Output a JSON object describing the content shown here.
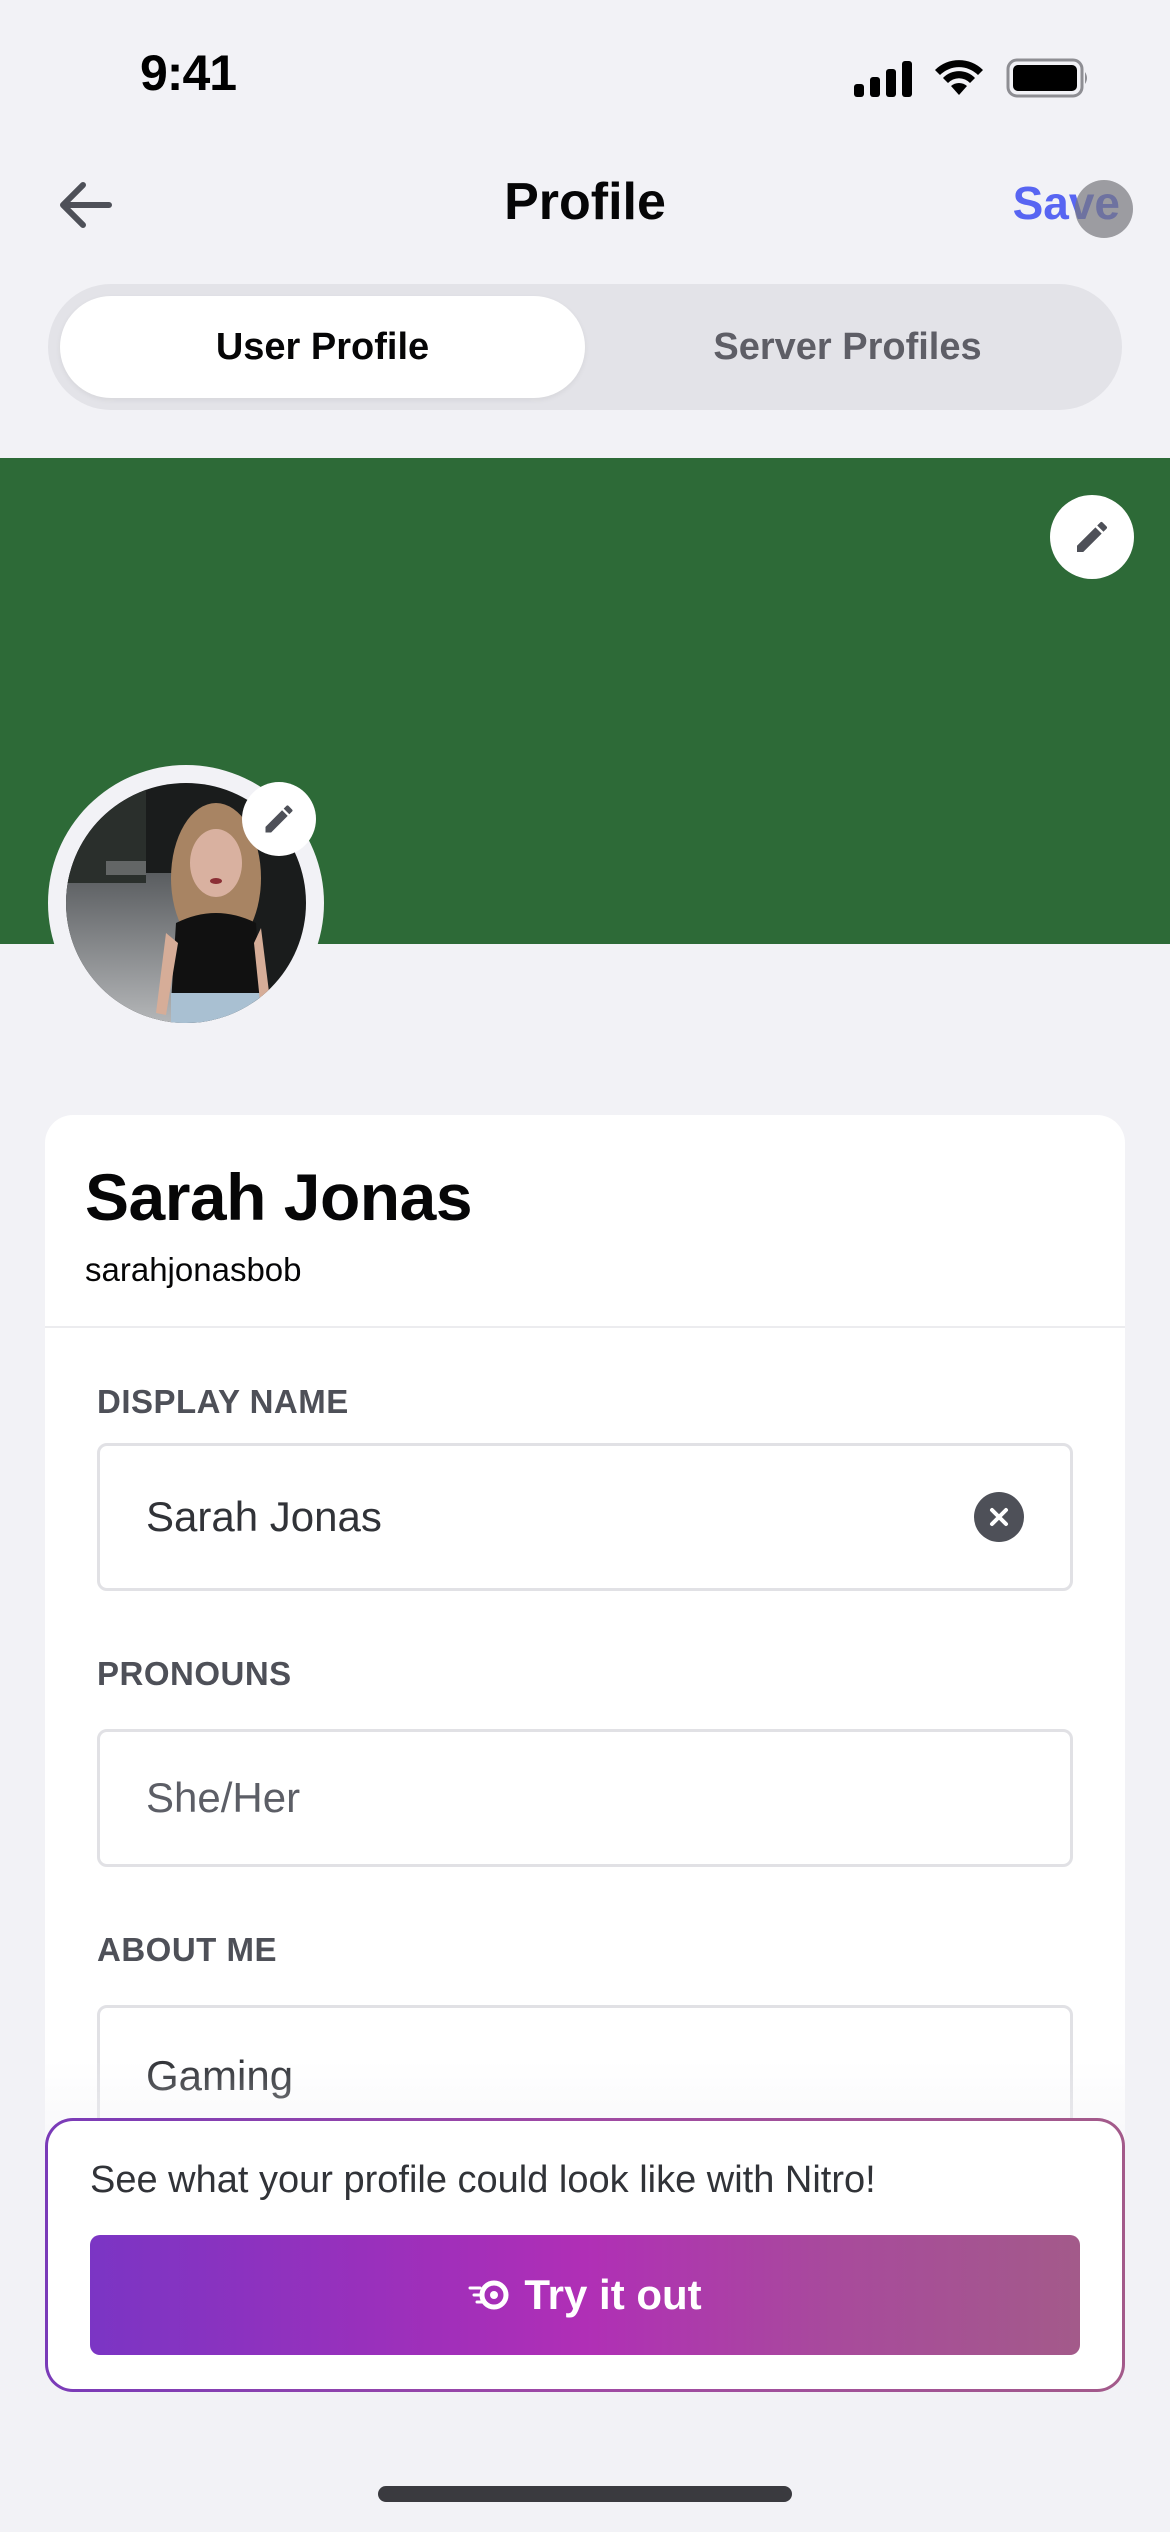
{
  "status_bar": {
    "time": "9:41",
    "icons": [
      "cellular-signal-icon",
      "wifi-icon",
      "battery-icon"
    ]
  },
  "nav": {
    "back_icon": "arrow-left-icon",
    "title": "Profile",
    "save_label": "Save"
  },
  "tabs": [
    {
      "label": "User Profile",
      "active": true
    },
    {
      "label": "Server Profiles",
      "active": false
    }
  ],
  "banner": {
    "color": "#2d6a37",
    "edit_icon": "pencil-icon"
  },
  "avatar": {
    "description": "Profile photo of a woman with long blonde hair in a black tank top",
    "edit_icon": "pencil-icon"
  },
  "profile": {
    "display_name": "Sarah Jonas",
    "username": "sarahjonasbob"
  },
  "form": {
    "display_name": {
      "label": "DISPLAY NAME",
      "value": "Sarah Jonas",
      "clear_icon": "clear-circle-icon"
    },
    "pronouns": {
      "label": "PRONOUNS",
      "placeholder": "She/Her",
      "value": ""
    },
    "about_me": {
      "label": "ABOUT ME",
      "value": "Gaming"
    }
  },
  "nitro_promo": {
    "text": "See what your profile could look like with Nitro!",
    "button_label": "Try it out",
    "button_icon": "nitro-icon"
  },
  "colors": {
    "accent": "#5865f2",
    "banner": "#2d6a37",
    "nitro_gradient_start": "#7b35c4",
    "nitro_gradient_end": "#a35a8a"
  }
}
